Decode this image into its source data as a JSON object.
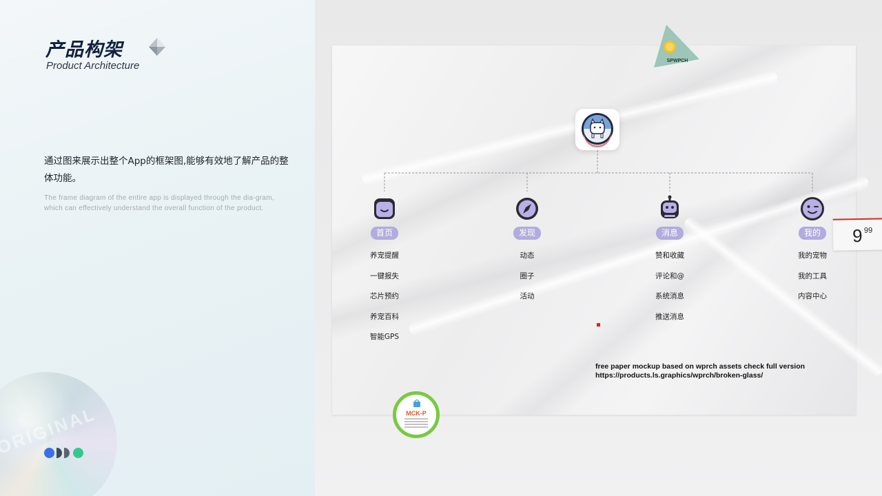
{
  "header": {
    "title_zh": "产品构架",
    "title_en": "Product Architecture"
  },
  "intro": {
    "zh": "通过图来展示出整个App的框架图,能够有效地了解产品的整体功能。",
    "en": "The frame diagram of the entire app is displayed through the dia-gram, which can effectively understand the overall function of the product."
  },
  "holo_disc_text": "ORIGINAL",
  "sticker_triangle_label": "SPWPCH",
  "columns": [
    {
      "tag": "首页",
      "icon": "home-face-icon",
      "items": [
        "养宠提醒",
        "一键报失",
        "芯片预约",
        "养宠百科",
        "智能GPS"
      ]
    },
    {
      "tag": "发现",
      "icon": "compass-icon",
      "items": [
        "动态",
        "圈子",
        "活动"
      ]
    },
    {
      "tag": "消息",
      "icon": "robot-message-icon",
      "items": [
        "赞和收藏",
        "评论和@",
        "系统消息",
        "推送消息"
      ]
    },
    {
      "tag": "我的",
      "icon": "wink-face-icon",
      "items": [
        "我的宠物",
        "我的工具",
        "内容中心"
      ]
    }
  ],
  "mockup_note": {
    "line1": "free paper mockup based on wprch assets check full version",
    "line2": "https://products.ls.graphics/wprch/broken-glass/"
  },
  "price_tag": {
    "main": "9",
    "sup": "99"
  },
  "mck_sticker": {
    "title": "MCK-P"
  },
  "colors": {
    "accent_purple": "#b2abdd",
    "title_navy": "#13203f",
    "dot_blue": "#3d6fe8",
    "dot_green": "#35c88d",
    "sticker_green": "#79c943"
  }
}
